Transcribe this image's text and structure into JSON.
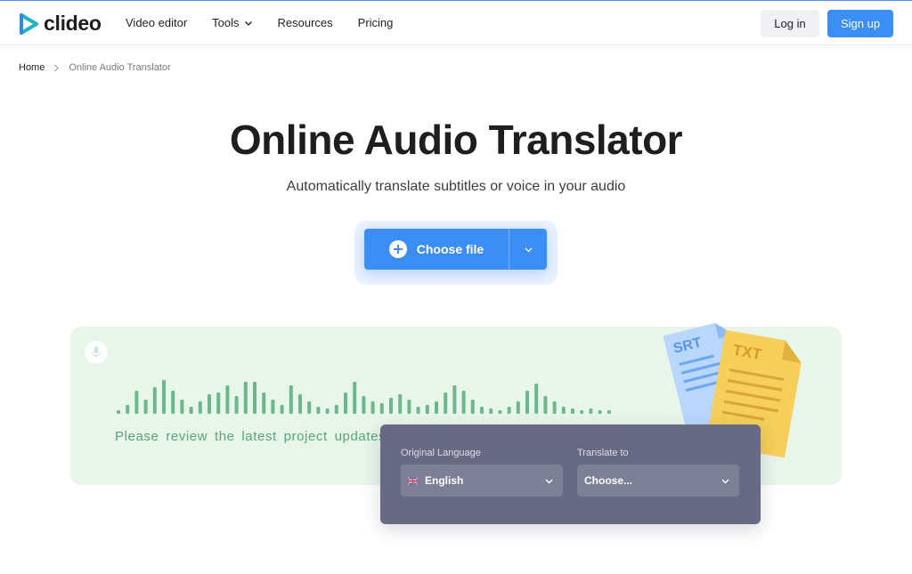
{
  "header": {
    "logo_text": "clideo",
    "nav": [
      {
        "label": "Video editor"
      },
      {
        "label": "Tools",
        "has_dropdown": true
      },
      {
        "label": "Resources"
      },
      {
        "label": "Pricing"
      }
    ],
    "login_label": "Log in",
    "signup_label": "Sign up"
  },
  "breadcrumb": {
    "home": "Home",
    "current": "Online Audio Translator"
  },
  "hero": {
    "title": "Online Audio Translator",
    "subtitle": "Automatically translate subtitles or voice in your audio",
    "choose_label": "Choose file"
  },
  "demo": {
    "transcript_visible": "Please review the latest project updates",
    "docs": [
      "SRT",
      "TXT"
    ]
  },
  "language": {
    "original_label": "Original Language",
    "original_value": "English",
    "target_label": "Translate to",
    "target_value": "Choose..."
  },
  "colors": {
    "accent": "#3b8ef6",
    "demo_bg": "#e8f5ea",
    "wave": "#6cb88a",
    "panel": "#686a84"
  }
}
